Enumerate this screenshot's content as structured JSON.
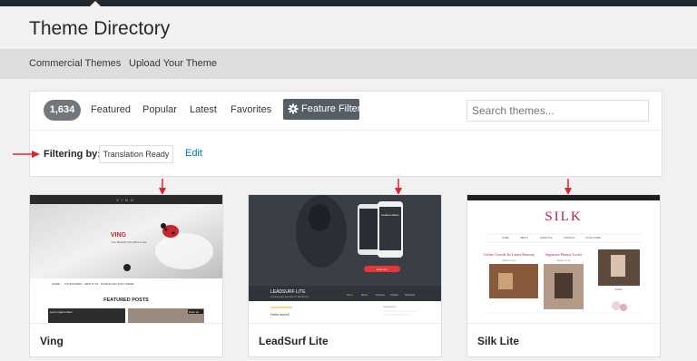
{
  "header": {
    "title": "Theme Directory"
  },
  "subnav": {
    "items": [
      {
        "label": "Commercial Themes"
      },
      {
        "label": "Upload Your Theme"
      }
    ]
  },
  "filter_bar": {
    "count": "1,634",
    "tabs": [
      {
        "label": "Featured"
      },
      {
        "label": "Popular"
      },
      {
        "label": "Latest"
      },
      {
        "label": "Favorites"
      }
    ],
    "feature_filter_label": "Feature Filter",
    "search_placeholder": "Search themes..."
  },
  "filtering": {
    "label": "Filtering by:",
    "tag": "Translation Ready",
    "edit_label": "Edit"
  },
  "themes": [
    {
      "name": "Ving",
      "preview": {
        "logo": "VING",
        "hero_title": "VING",
        "hero_sub": "Your Beautiful WordPress site",
        "nav": [
          "HOME",
          "CATEGORIES",
          "ABOUT US",
          "DOWNLOAD THIS THEME"
        ],
        "section_heading": "FEATURED POSTS",
        "post_label_left": "Lorem ipsum dolor",
        "post_label_right": "Dolor sit"
      }
    },
    {
      "name": "LeadSurf Lite",
      "preview": {
        "brand": "LEADSURF LITE",
        "brand_sub": "Landing page template for WordPress",
        "phone_title": "Feature Name",
        "phone_button": "Find Out",
        "nav": [
          "Home",
          "About",
          "Features",
          "Contact",
          "Subscribe"
        ],
        "body_line_left": "Hello world!",
        "body_line_right": "Categories"
      }
    },
    {
      "name": "Silk Lite",
      "preview": {
        "logo": "SILK",
        "nav": [
          "HOME",
          "ABOUT",
          "LIFESTYLE",
          "CONTACT",
          "STYLE GUIDE"
        ],
        "left_title": "Celine Crowds Its Latest Runway",
        "left_sub": "Read more",
        "mid_title": "Signature Beauty Looks",
        "mid_sub": "Read more",
        "right_title": "Pretty"
      }
    }
  ]
}
